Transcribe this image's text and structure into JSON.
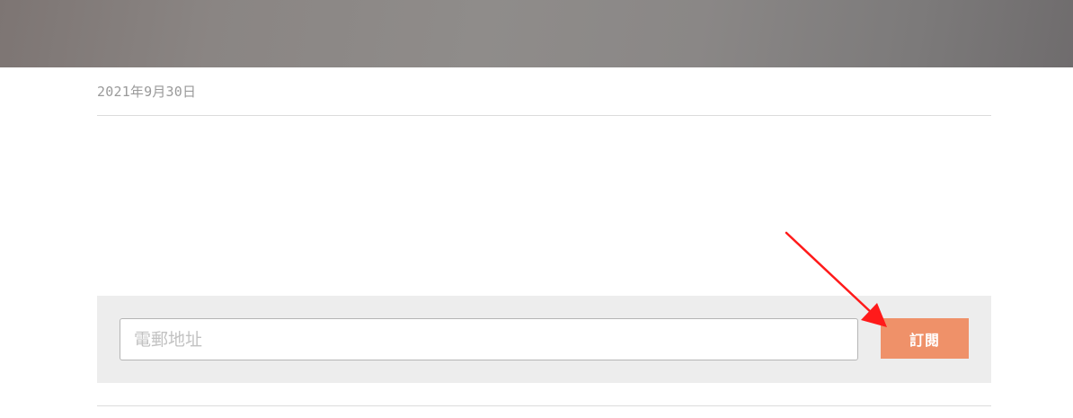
{
  "post": {
    "date": "2021年9月30日"
  },
  "subscribe": {
    "email_placeholder": "電郵地址",
    "email_value": "",
    "button_label": "訂閱"
  },
  "colors": {
    "accent": "#ef9169",
    "annotation_arrow": "#ff1a1a"
  }
}
